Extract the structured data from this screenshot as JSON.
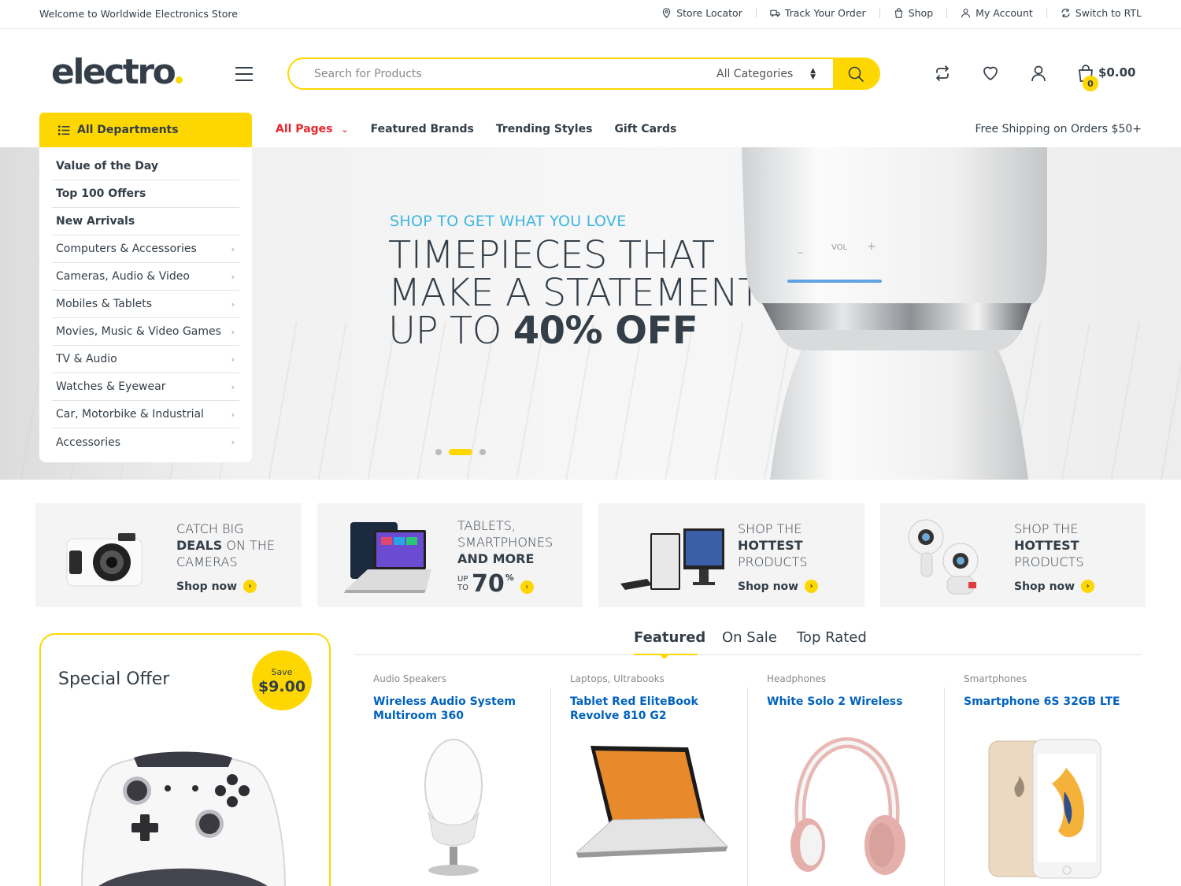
{
  "topbar": {
    "welcome": "Welcome to Worldwide Electronics Store",
    "links": [
      {
        "label": "Store Locator",
        "icon": "map-pin-icon"
      },
      {
        "label": "Track Your Order",
        "icon": "truck-icon"
      },
      {
        "label": "Shop",
        "icon": "shopping-bag-icon"
      },
      {
        "label": "My Account",
        "icon": "user-icon"
      },
      {
        "label": "Switch to RTL",
        "icon": "refresh-icon"
      }
    ]
  },
  "header": {
    "logo": "electro",
    "search_placeholder": "Search for Products",
    "category_selected": "All Categories",
    "cart_amount": "$0.00",
    "cart_count": "0"
  },
  "nav": {
    "all_departments": "All Departments",
    "items": [
      "All Pages",
      "Featured Brands",
      "Trending Styles",
      "Gift Cards"
    ],
    "free_shipping": "Free Shipping on Orders $50+"
  },
  "departments": [
    {
      "label": "Value of the Day",
      "bold": true
    },
    {
      "label": "Top 100 Offers",
      "bold": true
    },
    {
      "label": "New Arrivals",
      "bold": true
    },
    {
      "label": "Computers & Accessories"
    },
    {
      "label": "Cameras, Audio & Video"
    },
    {
      "label": "Mobiles & Tablets"
    },
    {
      "label": "Movies, Music & Video Games"
    },
    {
      "label": "TV & Audio"
    },
    {
      "label": "Watches & Eyewear"
    },
    {
      "label": "Car, Motorbike & Industrial"
    },
    {
      "label": "Accessories"
    }
  ],
  "hero": {
    "subtitle": "SHOP TO GET WHAT YOU LOVE",
    "line1": "TIMEPIECES THAT",
    "line2": "MAKE A STATEMENT",
    "line3_light": "UP TO",
    "line3_bold": "40% OFF",
    "active_slide": 2
  },
  "banners": [
    {
      "l1": "CATCH BIG",
      "l2b": "DEALS",
      "l2": " ON THE",
      "l3": "CAMERAS",
      "cta": "Shop now"
    },
    {
      "l1": "TABLETS,",
      "l2": "SMARTPHONES",
      "l3b": "AND MORE",
      "up": "UP",
      "to": "TO",
      "pct": "70",
      "pct_sym": "%"
    },
    {
      "l1": "SHOP THE",
      "l2b": "HOTTEST",
      "l3": "PRODUCTS",
      "cta": "Shop now"
    },
    {
      "l1": "SHOP THE",
      "l2b": "HOTTEST",
      "l3": "PRODUCTS",
      "cta": "Shop now"
    }
  ],
  "special_offer": {
    "title": "Special Offer",
    "save_label": "Save",
    "save_amount": "$9.00"
  },
  "tabs": [
    "Featured",
    "On Sale",
    "Top Rated"
  ],
  "products": [
    {
      "category": "Audio Speakers",
      "name": "Wireless Audio System Multiroom 360"
    },
    {
      "category": "Laptops, Ultrabooks",
      "name": "Tablet Red EliteBook Revolve 810 G2"
    },
    {
      "category": "Headphones",
      "name": "White Solo 2 Wireless"
    },
    {
      "category": "Smartphones",
      "name": "Smartphone 6S 32GB LTE"
    }
  ],
  "colors": {
    "accent": "#fed700",
    "text": "#333e48",
    "link": "#0062bd",
    "hero_sub": "#3fb6e0",
    "nav_red": "#e8262b"
  }
}
